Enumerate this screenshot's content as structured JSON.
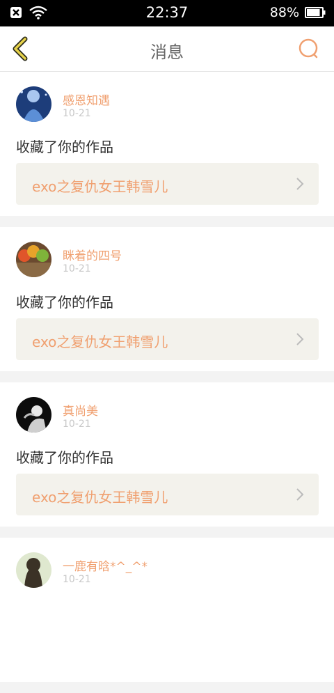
{
  "status_bar": {
    "time": "22:37",
    "battery": "88%",
    "battery_level": 0.88,
    "icons": [
      "notification-x-icon",
      "wifi-icon",
      "battery-icon"
    ]
  },
  "header": {
    "title": "消息",
    "back_icon": "chevron-left-icon",
    "search_icon": "search-icon",
    "accent": "#f0a070"
  },
  "messages": [
    {
      "username": "感恩知遇",
      "date": "10-21",
      "action": "收藏了你的作品",
      "work_title": "exo之复仇女王韩雪儿"
    },
    {
      "username": "眯着的四号",
      "date": "10-21",
      "action": "收藏了你的作品",
      "work_title": "exo之复仇女王韩雪儿"
    },
    {
      "username": "真尚美",
      "date": "10-21",
      "action": "收藏了你的作品",
      "work_title": "exo之复仇女王韩雪儿"
    },
    {
      "username": "一鹿有晗*^_^*",
      "date": "10-21",
      "action": "",
      "work_title": ""
    }
  ]
}
